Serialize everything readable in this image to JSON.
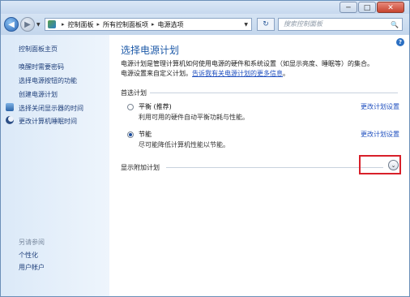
{
  "window": {
    "minimize_glyph": "─",
    "maximize_glyph": "□",
    "close_glyph": "✕"
  },
  "nav": {
    "back_glyph": "◀",
    "forward_glyph": "▶",
    "breadcrumb": [
      "控制面板",
      "所有控制面板项",
      "电源选项"
    ],
    "breadcrumb_sep": "▸",
    "refresh_glyph": "↻",
    "search_placeholder": "搜索控制面板",
    "search_icon": "🔍"
  },
  "sidebar": {
    "top_items": [
      {
        "label": "控制面板主页",
        "icon": ""
      },
      {
        "label": "唤醒时需要密码",
        "icon": ""
      },
      {
        "label": "选择电源按钮的功能",
        "icon": ""
      },
      {
        "label": "创建电源计划",
        "icon": ""
      },
      {
        "label": "选择关闭显示器的时间",
        "icon": "monitor-icon"
      },
      {
        "label": "更改计算机睡眠时间",
        "icon": "moon-icon"
      }
    ],
    "see_also": "另请参阅",
    "bottom_items": [
      "个性化",
      "用户帐户"
    ]
  },
  "main": {
    "title": "选择电源计划",
    "desc_line1": "电源计划是管理计算机如何使用电源的硬件和系统设置（如显示亮度、睡眠等）的集合。",
    "desc_line2_pre": "电源设置来自定义计划。",
    "desc_link": "告诉我有关电源计划的更多信息",
    "desc_line2_post": "。",
    "section_label": "首选计划",
    "plans": [
      {
        "name": "平衡 (推荐)",
        "desc": "利用可用的硬件自动平衡功耗与性能。",
        "selected": false,
        "link": "更改计划设置"
      },
      {
        "name": "节能",
        "desc": "尽可能降低计算机性能以节能。",
        "selected": true,
        "link": "更改计划设置"
      }
    ],
    "show_more": "显示附加计划",
    "expand_glyph": "⌄"
  },
  "help_glyph": "?"
}
